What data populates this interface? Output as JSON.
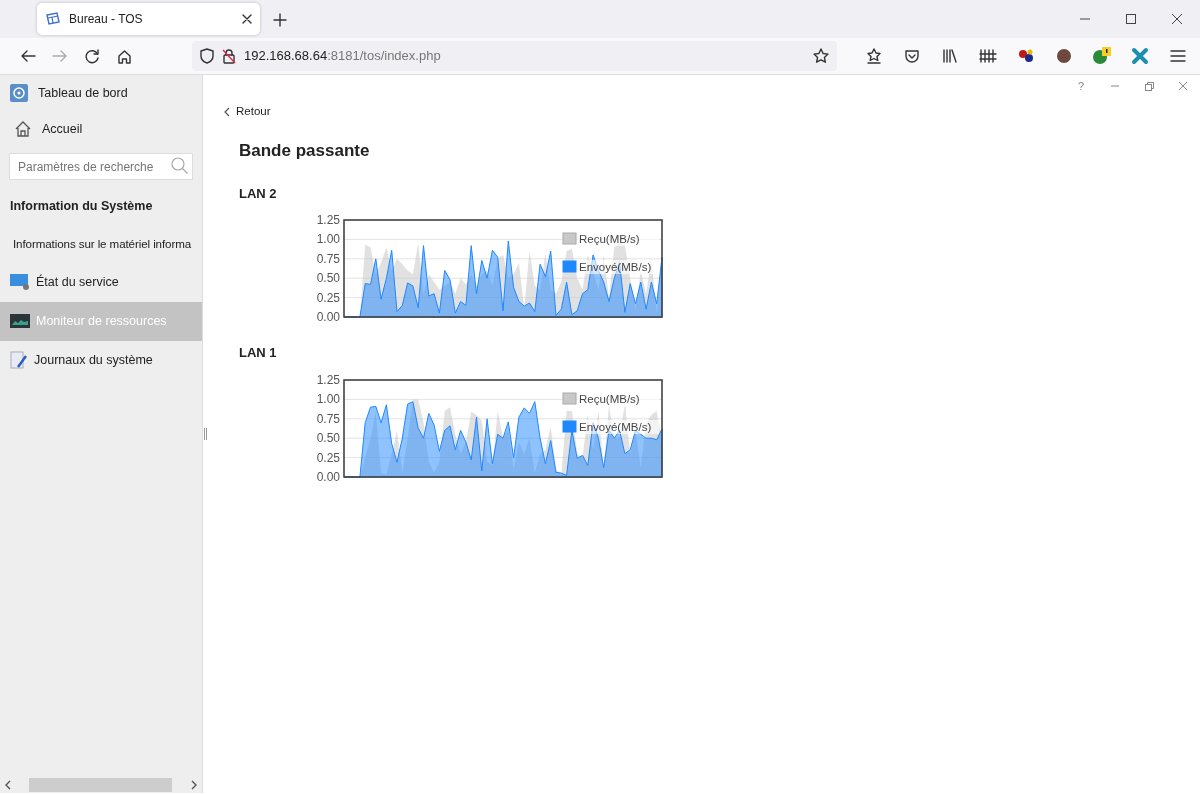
{
  "browser": {
    "tabs": [
      {
        "title": "Bureau - TOS",
        "selected": true
      }
    ],
    "url": {
      "host": "192.168.68.64",
      "rest": ":8181/tos/index.php"
    }
  },
  "window": {
    "help": "?"
  },
  "sidebar": {
    "items": [
      {
        "label": "Tableau de bord",
        "selected": false
      },
      {
        "label": "Accueil",
        "selected": false
      }
    ],
    "search": {
      "placeholder": "Paramètres de recherche"
    },
    "section": "Information du Système",
    "nav": [
      {
        "label": "Informations sur le matériel informa",
        "selected": false
      },
      {
        "label": "État du service",
        "selected": false
      },
      {
        "label": "Moniteur de ressources",
        "selected": true
      },
      {
        "label": "Journaux du système",
        "selected": false
      }
    ]
  },
  "main": {
    "back": "Retour",
    "title": "Bande passante",
    "panels": [
      {
        "label": "LAN 2",
        "chart_data": {
          "type": "area",
          "grid": true,
          "legend": true,
          "ylim": [
            0,
            1.25
          ],
          "yticks": [
            {
              "value": 0,
              "label": "0.00"
            },
            {
              "value": 0.25,
              "label": "0.25"
            },
            {
              "value": 0.5,
              "label": "0.50"
            },
            {
              "value": 0.75,
              "label": "0.75"
            },
            {
              "value": 1,
              "label": "1.00"
            },
            {
              "value": 1.25,
              "label": "1.25"
            }
          ],
          "series": [
            {
              "name": "Reçu(MB/s)",
              "color": "#c8c8c8",
              "values": [
                0,
                0,
                0,
                0,
                0.93,
                0.9,
                0.55,
                0.7,
                0.9,
                0.6,
                0.75,
                0.68,
                0.6,
                0.55,
                0.95,
                0.3,
                0.55,
                0.45,
                0.35,
                0.4,
                0.45,
                0.3,
                0.5,
                0.42,
                0.55,
                0.4,
                0.55,
                0.6,
                0.4,
                0.75,
                0.8,
                0.5,
                0.55,
                0.7,
                0.1,
                0.85,
                0.4,
                0.35,
                0.82,
                0.35,
                0.3,
                0.45,
                0.85,
                0.88,
                0.5,
                0.35,
                0.8,
                0.6,
                0.35,
                0.8,
                0.25,
                0.9,
                0.95,
                0.92,
                0.5,
                0.1,
                0.6,
                0.3,
                0.75,
                0.05,
                0.8
              ]
            },
            {
              "name": "Envoyé(MB/s)",
              "color": "#1e88ff",
              "values": [
                0,
                0,
                0,
                0,
                0.43,
                0.42,
                0.75,
                0.23,
                0.5,
                0.86,
                0.07,
                0.15,
                0.44,
                0.4,
                0.12,
                0.92,
                0.27,
                0.3,
                0.05,
                0.6,
                0.48,
                0.05,
                0.2,
                0.15,
                0.92,
                0.3,
                0.73,
                0.5,
                0.86,
                0.77,
                0.08,
                0.98,
                0.38,
                0.2,
                0.14,
                0.18,
                0.07,
                0.68,
                0.52,
                0.85,
                0.02,
                0.1,
                0.45,
                0.03,
                0.08,
                0.3,
                0.35,
                0.8,
                0.6,
                0.45,
                0.2,
                0.5,
                0.7,
                0.06,
                0.43,
                0.17,
                0.45,
                0.1,
                0.45,
                0.17,
                0.77
              ]
            }
          ]
        }
      },
      {
        "label": "LAN 1",
        "chart_data": {
          "type": "area",
          "grid": true,
          "legend": true,
          "ylim": [
            0,
            1.25
          ],
          "yticks": [
            {
              "value": 0,
              "label": "0.00"
            },
            {
              "value": 0.25,
              "label": "0.25"
            },
            {
              "value": 0.5,
              "label": "0.50"
            },
            {
              "value": 0.75,
              "label": "0.75"
            },
            {
              "value": 1,
              "label": "1.00"
            },
            {
              "value": 1.25,
              "label": "1.25"
            }
          ],
          "series": [
            {
              "name": "Reçu(MB/s)",
              "color": "#c8c8c8",
              "values": [
                null,
                null,
                null,
                0,
                0.25,
                0.5,
                0.85,
                0.05,
                0.03,
                0.3,
                0.6,
                0.05,
                0.5,
                1.0,
                1.0,
                0.7,
                0.2,
                0.05,
                0.2,
                0.85,
                0.9,
                0.55,
                0.3,
                0.45,
                0.84,
                0.8,
                0.72,
                0.2,
                0.15,
                0.85,
                0.5,
                0.6,
                0.1,
                0.45,
                0.3,
                0.5,
                0.05,
                0.3,
                0.35,
                0.65,
                0.1,
                0.02,
                0.85,
                0.85,
                0.3,
                0.25,
                0.8,
                0.35,
                0.85,
                0.1,
                0.92,
                0.5,
                0.5,
                0.95,
                0.3,
                0.6,
                0.12,
                0.7,
                0.8,
                0.85,
                0.45
              ]
            },
            {
              "name": "Envoyé(MB/s)",
              "color": "#1e88ff",
              "values": [
                0,
                0,
                0,
                0,
                0.7,
                0.9,
                0.91,
                0.7,
                0.93,
                0.43,
                0.19,
                0.5,
                0.94,
                0.97,
                0.63,
                0.5,
                0.82,
                0.67,
                0.33,
                0.6,
                0.66,
                0.35,
                0.6,
                0.45,
                0.22,
                0.77,
                0.08,
                0.75,
                0.17,
                0.55,
                0.5,
                0.71,
                0.25,
                0.77,
                0.89,
                0.82,
                0.97,
                0.5,
                0.17,
                0.47,
                0.06,
                0.05,
                0.02,
                0.6,
                0.24,
                0.28,
                0.15,
                0.7,
                0.5,
                0.12,
                0.6,
                0.5,
                0.6,
                0.3,
                0.35,
                0.6,
                0.55,
                0.5,
                0.5,
                0.48,
                0.62
              ]
            }
          ]
        }
      }
    ]
  }
}
